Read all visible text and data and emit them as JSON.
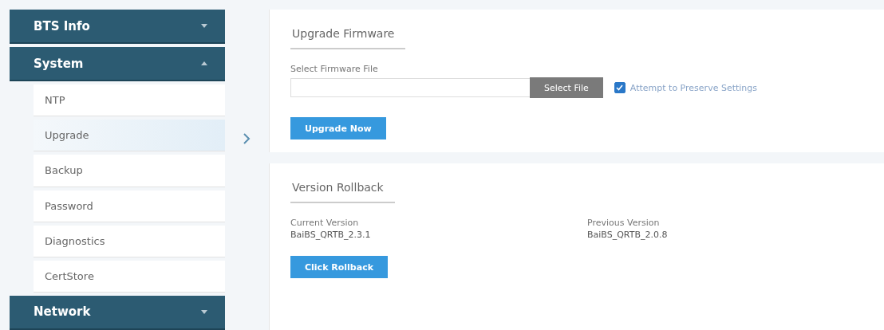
{
  "sidebar": {
    "sections": [
      {
        "title": "BTS Info",
        "expanded": false
      },
      {
        "title": "System",
        "expanded": true,
        "items": [
          {
            "label": "NTP",
            "selected": false
          },
          {
            "label": "Upgrade",
            "selected": true
          },
          {
            "label": "Backup",
            "selected": false
          },
          {
            "label": "Password",
            "selected": false
          },
          {
            "label": "Diagnostics",
            "selected": false
          },
          {
            "label": "CertStore",
            "selected": false
          }
        ]
      },
      {
        "title": "Network",
        "expanded": false
      }
    ]
  },
  "upgrade": {
    "title": "Upgrade Firmware",
    "field_label": "Select Firmware File",
    "select_button": "Select File",
    "preserve": {
      "label": "Attempt to Preserve Settings",
      "checked": true
    },
    "upgrade_button": "Upgrade Now"
  },
  "rollback": {
    "title": "Version Rollback",
    "versions": [
      {
        "label": "Current Version",
        "value": "BaiBS_QRTB_2.3.1"
      },
      {
        "label": "Previous Version",
        "value": "BaiBS_QRTB_2.0.8"
      }
    ],
    "button": "Click Rollback"
  }
}
